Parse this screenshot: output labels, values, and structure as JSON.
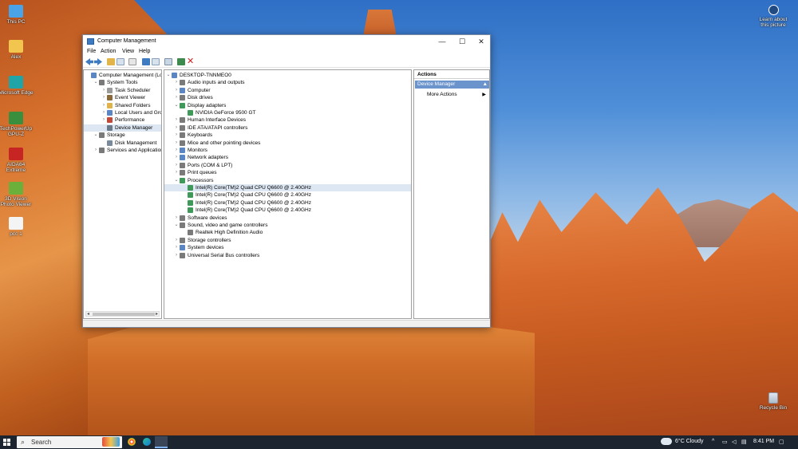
{
  "desktop": {
    "icons_left": [
      {
        "label": "This PC",
        "icon": "this-pc-icon",
        "color": "#4aa3e6"
      },
      {
        "label": "Alex",
        "icon": "user-folder-icon",
        "color": "#f2c54e"
      },
      {
        "label": "Microsoft Edge",
        "icon": "edge-icon",
        "color": "#1fa4a8"
      },
      {
        "label": "TechPowerUp GPU-Z",
        "icon": "gpuz-icon",
        "color": "#3a8f3e"
      },
      {
        "label": "AIDA64 Extreme",
        "icon": "aida64-icon",
        "color": "#c72424"
      },
      {
        "label": "3D Vision Photo Viewer",
        "icon": "3d-vision-icon",
        "color": "#6bb03a"
      },
      {
        "label": "pcc 1",
        "icon": "file-icon",
        "color": "#f4f4f4"
      }
    ],
    "icon_top_right": {
      "label": "Learn about this picture",
      "icon": "camera-icon"
    },
    "recycle_bin": {
      "label": "Recycle Bin",
      "icon": "recycle-bin-icon"
    }
  },
  "window": {
    "title": "Computer Management",
    "controls": {
      "minimize": "—",
      "maximize": "☐",
      "close": "✕"
    },
    "menu": [
      "File",
      "Action",
      "View",
      "Help"
    ],
    "left_tree": [
      {
        "label": "Computer Management (Local",
        "level": 0,
        "expander": "",
        "icon_color": "#5b86c4"
      },
      {
        "label": "System Tools",
        "level": 1,
        "expander": "v",
        "icon_color": "#7a7a7a"
      },
      {
        "label": "Task Scheduler",
        "level": 2,
        "expander": ">",
        "icon_color": "#9a9a9a"
      },
      {
        "label": "Event Viewer",
        "level": 2,
        "expander": ">",
        "icon_color": "#8a6a3a"
      },
      {
        "label": "Shared Folders",
        "level": 2,
        "expander": ">",
        "icon_color": "#e0b24a"
      },
      {
        "label": "Local Users and Groups",
        "level": 2,
        "expander": ">",
        "icon_color": "#5b86c4"
      },
      {
        "label": "Performance",
        "level": 2,
        "expander": ">",
        "icon_color": "#c04a3a"
      },
      {
        "label": "Device Manager",
        "level": 2,
        "expander": "",
        "icon_color": "#6a7a8a",
        "selected": true
      },
      {
        "label": "Storage",
        "level": 1,
        "expander": "v",
        "icon_color": "#7a7a7a"
      },
      {
        "label": "Disk Management",
        "level": 2,
        "expander": "",
        "icon_color": "#7a8a9a"
      },
      {
        "label": "Services and Applications",
        "level": 1,
        "expander": ">",
        "icon_color": "#7a7a7a"
      }
    ],
    "device_tree": [
      {
        "label": "DESKTOP-TNNMEO0",
        "level": 0,
        "expander": "v",
        "icon_color": "#5b86c4"
      },
      {
        "label": "Audio inputs and outputs",
        "level": 1,
        "expander": ">",
        "icon_color": "#7a7a7a"
      },
      {
        "label": "Computer",
        "level": 1,
        "expander": ">",
        "icon_color": "#5b86c4"
      },
      {
        "label": "Disk drives",
        "level": 1,
        "expander": ">",
        "icon_color": "#7a7a7a"
      },
      {
        "label": "Display adapters",
        "level": 1,
        "expander": "v",
        "icon_color": "#3f9a5a"
      },
      {
        "label": "NVIDIA GeForce 9500 GT",
        "level": 2,
        "expander": "",
        "icon_color": "#3f9a5a"
      },
      {
        "label": "Human Interface Devices",
        "level": 1,
        "expander": ">",
        "icon_color": "#7a7a7a"
      },
      {
        "label": "IDE ATA/ATAPI controllers",
        "level": 1,
        "expander": ">",
        "icon_color": "#7a7a7a"
      },
      {
        "label": "Keyboards",
        "level": 1,
        "expander": ">",
        "icon_color": "#7a7a7a"
      },
      {
        "label": "Mice and other pointing devices",
        "level": 1,
        "expander": ">",
        "icon_color": "#7a7a7a"
      },
      {
        "label": "Monitors",
        "level": 1,
        "expander": ">",
        "icon_color": "#5b86c4"
      },
      {
        "label": "Network adapters",
        "level": 1,
        "expander": ">",
        "icon_color": "#5b86c4"
      },
      {
        "label": "Ports (COM & LPT)",
        "level": 1,
        "expander": ">",
        "icon_color": "#7a7a7a"
      },
      {
        "label": "Print queues",
        "level": 1,
        "expander": ">",
        "icon_color": "#7a7a7a"
      },
      {
        "label": "Processors",
        "level": 1,
        "expander": "v",
        "icon_color": "#3f9a5a"
      },
      {
        "label": "Intel(R) Core(TM)2 Quad CPU    Q6600  @ 2.40GHz",
        "level": 2,
        "expander": "",
        "icon_color": "#3f9a5a",
        "selected": true
      },
      {
        "label": "Intel(R) Core(TM)2 Quad CPU    Q6600  @ 2.40GHz",
        "level": 2,
        "expander": "",
        "icon_color": "#3f9a5a"
      },
      {
        "label": "Intel(R) Core(TM)2 Quad CPU    Q6600  @ 2.40GHz",
        "level": 2,
        "expander": "",
        "icon_color": "#3f9a5a"
      },
      {
        "label": "Intel(R) Core(TM)2 Quad CPU    Q6600  @ 2.40GHz",
        "level": 2,
        "expander": "",
        "icon_color": "#3f9a5a"
      },
      {
        "label": "Software devices",
        "level": 1,
        "expander": ">",
        "icon_color": "#7a7a7a"
      },
      {
        "label": "Sound, video and game controllers",
        "level": 1,
        "expander": "v",
        "icon_color": "#7a7a7a"
      },
      {
        "label": "Realtek High Definition Audio",
        "level": 2,
        "expander": "",
        "icon_color": "#7a7a7a"
      },
      {
        "label": "Storage controllers",
        "level": 1,
        "expander": ">",
        "icon_color": "#7a7a7a"
      },
      {
        "label": "System devices",
        "level": 1,
        "expander": ">",
        "icon_color": "#5b86c4"
      },
      {
        "label": "Universal Serial Bus controllers",
        "level": 1,
        "expander": ">",
        "icon_color": "#7a7a7a"
      }
    ],
    "actions": {
      "header": "Actions",
      "section": "Device Manager",
      "section_caret": "▲",
      "items": [
        {
          "label": "More Actions",
          "arrow": "▶"
        }
      ]
    }
  },
  "taskbar": {
    "search_placeholder": "Search",
    "weather": "6°C  Cloudy",
    "time": "8:41 PM"
  }
}
